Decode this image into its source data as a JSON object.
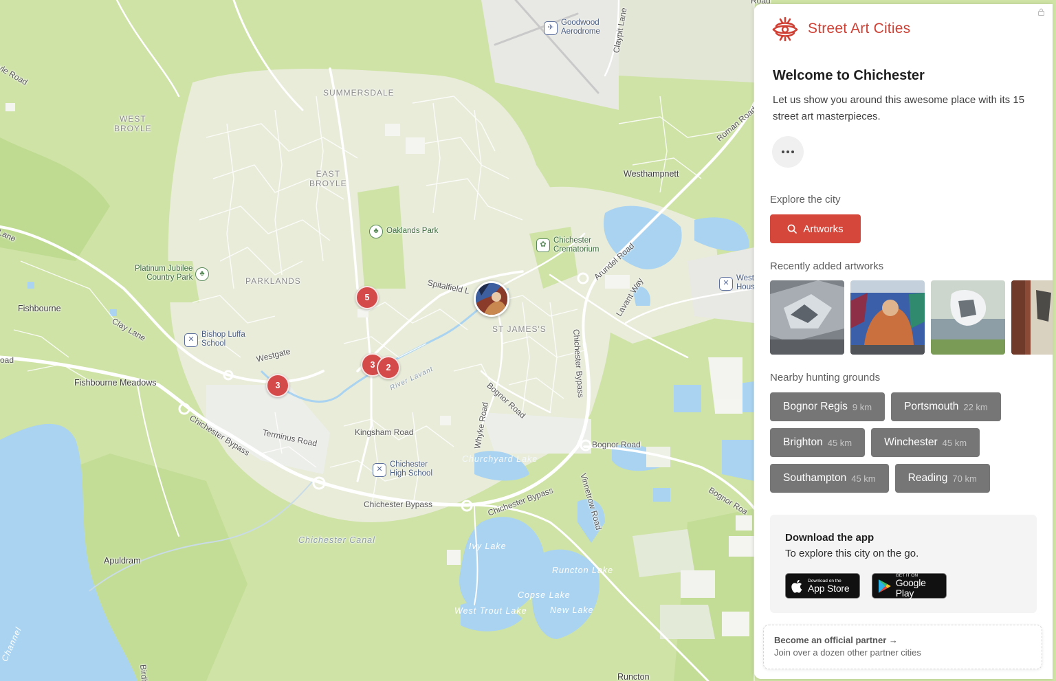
{
  "map": {
    "place_labels": [
      {
        "id": "fishbourne",
        "text": "Fishbourne"
      },
      {
        "id": "fishbourne-meadows",
        "text": "Fishbourne Meadows"
      },
      {
        "id": "apuldram",
        "text": "Apuldram"
      },
      {
        "id": "westhampnett",
        "text": "Westhampnett"
      },
      {
        "id": "runcton",
        "text": "Runcton"
      }
    ],
    "district_labels": [
      {
        "id": "summersdale",
        "text": "SUMMERSDALE"
      },
      {
        "id": "west-broyle",
        "text": "WEST\nBROYLE"
      },
      {
        "id": "east-broyle",
        "text": "EAST\nBROYLE"
      },
      {
        "id": "parklands",
        "text": "PARKLANDS"
      },
      {
        "id": "st-james",
        "text": "ST JAMES'S"
      }
    ],
    "road_labels": [
      {
        "id": "yle-road",
        "text": "yle Road"
      },
      {
        "id": "lane",
        "text": "Lane"
      },
      {
        "id": "clay-lane",
        "text": "Clay Lane"
      },
      {
        "id": "oad",
        "text": "oad"
      },
      {
        "id": "westgate",
        "text": "Westgate"
      },
      {
        "id": "chichester-bypass-w",
        "text": "Chichester Bypass"
      },
      {
        "id": "terminus-road",
        "text": "Terminus Road"
      },
      {
        "id": "kingsham-road",
        "text": "Kingsham Road"
      },
      {
        "id": "whyke-road",
        "text": "Whyke Road"
      },
      {
        "id": "bognor-road-n",
        "text": "Bognor Road"
      },
      {
        "id": "bognor-road-e",
        "text": "Bognor Road"
      },
      {
        "id": "bognor-road-se",
        "text": "Bognor Roa"
      },
      {
        "id": "chichester-bypass-s",
        "text": "Chichester Bypass"
      },
      {
        "id": "chichester-bypass-se",
        "text": "Chichester Bypass"
      },
      {
        "id": "chichester-bypass-e",
        "text": "Chichester Bypass"
      },
      {
        "id": "vinnetrow-road",
        "text": "Vinnetrow Road"
      },
      {
        "id": "spitalfield",
        "text": "Spitalfield L"
      },
      {
        "id": "arundel-road",
        "text": "Arundel Road"
      },
      {
        "id": "roman-road",
        "text": "Roman Road"
      },
      {
        "id": "claypit-lane",
        "text": "Claypit Lane"
      },
      {
        "id": "lavant-way",
        "text": "Lavant Way"
      },
      {
        "id": "birdham",
        "text": "Birdha"
      },
      {
        "id": "channel",
        "text": "Channel"
      },
      {
        "id": "road-top",
        "text": "Road"
      }
    ],
    "water_labels": [
      {
        "id": "churchyard-lake",
        "text": "Churchyard Lake"
      },
      {
        "id": "ivy-lake",
        "text": "Ivy Lake"
      },
      {
        "id": "runcton-lake",
        "text": "Runcton Lake"
      },
      {
        "id": "copse-lake",
        "text": "Copse Lake"
      },
      {
        "id": "west-trout-lake",
        "text": "West Trout Lake"
      },
      {
        "id": "new-lake",
        "text": "New Lake"
      },
      {
        "id": "chichester-canal",
        "text": "Chichester Canal"
      },
      {
        "id": "rivr-lavant",
        "text": "River Lavant"
      }
    ],
    "pois": [
      {
        "id": "goodwood",
        "text": "Goodwood\nAerodrome",
        "icon": "airport-icon"
      },
      {
        "id": "oaklands",
        "text": "Oaklands Park",
        "icon": "park-icon"
      },
      {
        "id": "crematorium",
        "text": "Chichester\nCrematorium",
        "icon": "cemetery-icon"
      },
      {
        "id": "platinum",
        "text": "Platinum Jubilee\nCountry Park",
        "icon": "park-icon"
      },
      {
        "id": "bishop",
        "text": "Bishop Luffa\nSchool",
        "icon": "school-icon"
      },
      {
        "id": "high-school",
        "text": "Chichester\nHigh School",
        "icon": "school-icon"
      },
      {
        "id": "west-hous",
        "text": "West\nHous",
        "icon": "school-icon"
      }
    ],
    "clusters": [
      {
        "id": "c5",
        "count": "5"
      },
      {
        "id": "c3a",
        "count": "3"
      },
      {
        "id": "c2",
        "count": "2"
      },
      {
        "id": "c3b",
        "count": "3"
      }
    ]
  },
  "panel": {
    "brand": "Street Art Cities",
    "welcome_title": "Welcome to Chichester",
    "intro": "Let us show you around this awesome place with its 15 street art masterpieces.",
    "explore_title": "Explore the city",
    "artworks_label": "Artworks",
    "recent_title": "Recently added artworks",
    "nearby_title": "Nearby hunting grounds",
    "nearby": [
      [
        {
          "name": "Bognor Regis",
          "dist": "9 km"
        },
        {
          "name": "Portsmouth",
          "dist": "22 km"
        }
      ],
      [
        {
          "name": "Brighton",
          "dist": "45 km"
        },
        {
          "name": "Winchester",
          "dist": "45 km"
        }
      ],
      [
        {
          "name": "Southampton",
          "dist": "45 km"
        },
        {
          "name": "Reading",
          "dist": "70 km"
        }
      ]
    ],
    "download_title": "Download the app",
    "download_sub": "To explore this city on the go.",
    "app_store_small": "Download on the",
    "app_store_big": "App Store",
    "google_small": "GET IT ON",
    "google_big": "Google Play",
    "partner_title": "Become an official partner →",
    "partner_sub": "Join over a dozen other partner cities"
  },
  "colors": {
    "accent": "#d4473a",
    "chip": "#767676",
    "cluster": "#d44a4a",
    "land": "#cfe3a6",
    "water": "#a9d3f0",
    "urban": "#e9eddc"
  }
}
